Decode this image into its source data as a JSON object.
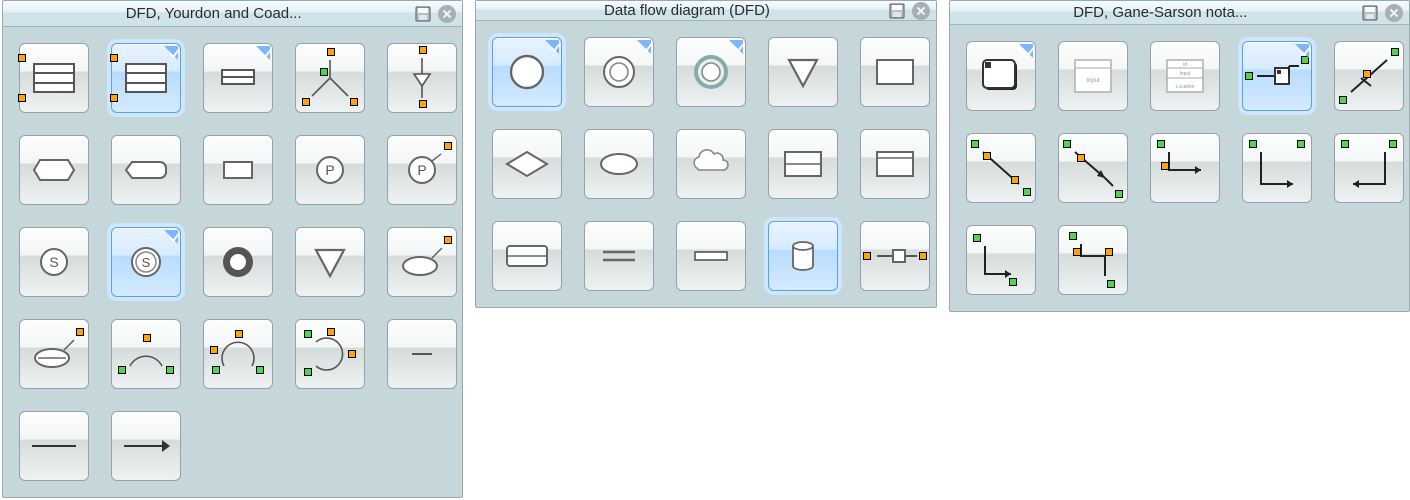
{
  "panels": [
    {
      "id": "yourdon",
      "title": "DFD, Yourdon and Coad...",
      "items": [
        {
          "name": "data-store-1",
          "corner": false,
          "sel": false
        },
        {
          "name": "data-store-2",
          "corner": true,
          "sel": true
        },
        {
          "name": "data-store-3",
          "corner": true,
          "sel": false
        },
        {
          "name": "tree-fork",
          "corner": false,
          "sel": false
        },
        {
          "name": "tree-merge",
          "corner": false,
          "sel": false
        },
        {
          "name": "hex-both",
          "corner": false,
          "sel": false
        },
        {
          "name": "hex-left",
          "corner": false,
          "sel": false
        },
        {
          "name": "hex-none",
          "corner": false,
          "sel": false
        },
        {
          "name": "p-circle",
          "corner": false,
          "sel": false
        },
        {
          "name": "p-circle-handle",
          "corner": false,
          "sel": false
        },
        {
          "name": "s-circle",
          "corner": false,
          "sel": false
        },
        {
          "name": "s-circle-sel",
          "corner": true,
          "sel": true
        },
        {
          "name": "ring",
          "corner": false,
          "sel": false
        },
        {
          "name": "triangle-down",
          "corner": false,
          "sel": false
        },
        {
          "name": "ellipse-line",
          "corner": false,
          "sel": false
        },
        {
          "name": "ellipse-line-2",
          "corner": false,
          "sel": false
        },
        {
          "name": "arc-nodes-1",
          "corner": false,
          "sel": false
        },
        {
          "name": "arc-nodes-2",
          "corner": false,
          "sel": false
        },
        {
          "name": "arc-nodes-3",
          "corner": false,
          "sel": false
        },
        {
          "name": "short-line",
          "corner": false,
          "sel": false
        },
        {
          "name": "line",
          "corner": false,
          "sel": false
        },
        {
          "name": "arrow",
          "corner": false,
          "sel": false
        }
      ]
    },
    {
      "id": "dfd",
      "title": "Data flow diagram (DFD)",
      "items": [
        {
          "name": "circle-solid",
          "corner": true,
          "sel": true
        },
        {
          "name": "circle-double",
          "corner": true,
          "sel": false
        },
        {
          "name": "circle-shaded",
          "corner": true,
          "sel": false
        },
        {
          "name": "triangle-down-2",
          "corner": false,
          "sel": false
        },
        {
          "name": "rect-solid",
          "corner": false,
          "sel": false
        },
        {
          "name": "diamond",
          "corner": false,
          "sel": false
        },
        {
          "name": "ellipse-solid",
          "corner": false,
          "sel": false
        },
        {
          "name": "cloud",
          "corner": false,
          "sel": false
        },
        {
          "name": "rect-mid",
          "corner": false,
          "sel": false
        },
        {
          "name": "rect-top",
          "corner": false,
          "sel": false
        },
        {
          "name": "rect-large",
          "corner": false,
          "sel": false
        },
        {
          "name": "two-lines",
          "corner": false,
          "sel": false
        },
        {
          "name": "rect-thin",
          "corner": false,
          "sel": false
        },
        {
          "name": "cylinder",
          "corner": false,
          "sel": true
        },
        {
          "name": "interface",
          "corner": false,
          "sel": false
        }
      ]
    },
    {
      "id": "gane",
      "title": "DFD, Gane-Sarson nota...",
      "items": [
        {
          "name": "process-box",
          "corner": true,
          "sel": false
        },
        {
          "name": "entity-box",
          "corner": false,
          "sel": false
        },
        {
          "name": "datastore-box",
          "corner": false,
          "sel": false
        },
        {
          "name": "connector-horiz",
          "corner": true,
          "sel": true
        },
        {
          "name": "connector-diag",
          "corner": false,
          "sel": false
        },
        {
          "name": "conn-a",
          "corner": false,
          "sel": false
        },
        {
          "name": "conn-b",
          "corner": false,
          "sel": false
        },
        {
          "name": "conn-c",
          "corner": false,
          "sel": false
        },
        {
          "name": "conn-d",
          "corner": false,
          "sel": false
        },
        {
          "name": "conn-e",
          "corner": false,
          "sel": false
        },
        {
          "name": "conn-f",
          "corner": false,
          "sel": false
        },
        {
          "name": "conn-g",
          "corner": false,
          "sel": false
        }
      ]
    }
  ]
}
